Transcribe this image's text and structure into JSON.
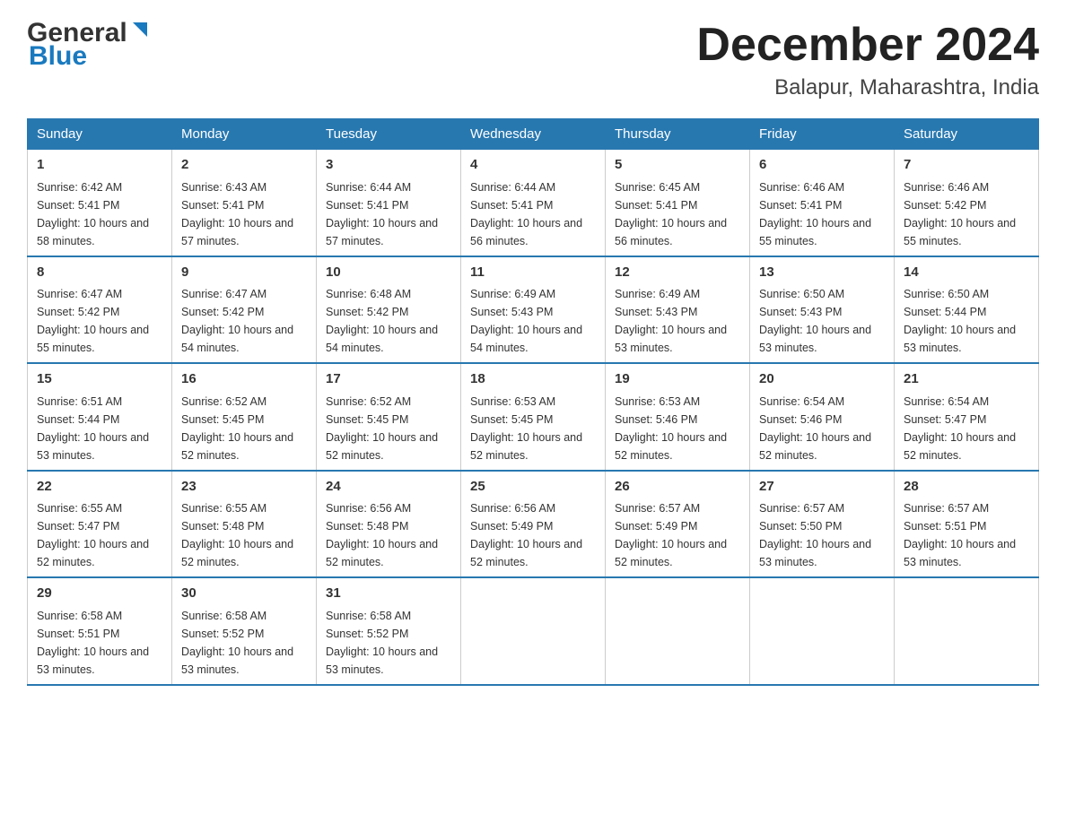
{
  "header": {
    "logo_line1": "General",
    "logo_line2": "Blue",
    "title": "December 2024",
    "subtitle": "Balapur, Maharashtra, India"
  },
  "days_of_week": [
    "Sunday",
    "Monday",
    "Tuesday",
    "Wednesday",
    "Thursday",
    "Friday",
    "Saturday"
  ],
  "weeks": [
    [
      {
        "num": "1",
        "sunrise": "6:42 AM",
        "sunset": "5:41 PM",
        "daylight": "10 hours and 58 minutes."
      },
      {
        "num": "2",
        "sunrise": "6:43 AM",
        "sunset": "5:41 PM",
        "daylight": "10 hours and 57 minutes."
      },
      {
        "num": "3",
        "sunrise": "6:44 AM",
        "sunset": "5:41 PM",
        "daylight": "10 hours and 57 minutes."
      },
      {
        "num": "4",
        "sunrise": "6:44 AM",
        "sunset": "5:41 PM",
        "daylight": "10 hours and 56 minutes."
      },
      {
        "num": "5",
        "sunrise": "6:45 AM",
        "sunset": "5:41 PM",
        "daylight": "10 hours and 56 minutes."
      },
      {
        "num": "6",
        "sunrise": "6:46 AM",
        "sunset": "5:41 PM",
        "daylight": "10 hours and 55 minutes."
      },
      {
        "num": "7",
        "sunrise": "6:46 AM",
        "sunset": "5:42 PM",
        "daylight": "10 hours and 55 minutes."
      }
    ],
    [
      {
        "num": "8",
        "sunrise": "6:47 AM",
        "sunset": "5:42 PM",
        "daylight": "10 hours and 55 minutes."
      },
      {
        "num": "9",
        "sunrise": "6:47 AM",
        "sunset": "5:42 PM",
        "daylight": "10 hours and 54 minutes."
      },
      {
        "num": "10",
        "sunrise": "6:48 AM",
        "sunset": "5:42 PM",
        "daylight": "10 hours and 54 minutes."
      },
      {
        "num": "11",
        "sunrise": "6:49 AM",
        "sunset": "5:43 PM",
        "daylight": "10 hours and 54 minutes."
      },
      {
        "num": "12",
        "sunrise": "6:49 AM",
        "sunset": "5:43 PM",
        "daylight": "10 hours and 53 minutes."
      },
      {
        "num": "13",
        "sunrise": "6:50 AM",
        "sunset": "5:43 PM",
        "daylight": "10 hours and 53 minutes."
      },
      {
        "num": "14",
        "sunrise": "6:50 AM",
        "sunset": "5:44 PM",
        "daylight": "10 hours and 53 minutes."
      }
    ],
    [
      {
        "num": "15",
        "sunrise": "6:51 AM",
        "sunset": "5:44 PM",
        "daylight": "10 hours and 53 minutes."
      },
      {
        "num": "16",
        "sunrise": "6:52 AM",
        "sunset": "5:45 PM",
        "daylight": "10 hours and 52 minutes."
      },
      {
        "num": "17",
        "sunrise": "6:52 AM",
        "sunset": "5:45 PM",
        "daylight": "10 hours and 52 minutes."
      },
      {
        "num": "18",
        "sunrise": "6:53 AM",
        "sunset": "5:45 PM",
        "daylight": "10 hours and 52 minutes."
      },
      {
        "num": "19",
        "sunrise": "6:53 AM",
        "sunset": "5:46 PM",
        "daylight": "10 hours and 52 minutes."
      },
      {
        "num": "20",
        "sunrise": "6:54 AM",
        "sunset": "5:46 PM",
        "daylight": "10 hours and 52 minutes."
      },
      {
        "num": "21",
        "sunrise": "6:54 AM",
        "sunset": "5:47 PM",
        "daylight": "10 hours and 52 minutes."
      }
    ],
    [
      {
        "num": "22",
        "sunrise": "6:55 AM",
        "sunset": "5:47 PM",
        "daylight": "10 hours and 52 minutes."
      },
      {
        "num": "23",
        "sunrise": "6:55 AM",
        "sunset": "5:48 PM",
        "daylight": "10 hours and 52 minutes."
      },
      {
        "num": "24",
        "sunrise": "6:56 AM",
        "sunset": "5:48 PM",
        "daylight": "10 hours and 52 minutes."
      },
      {
        "num": "25",
        "sunrise": "6:56 AM",
        "sunset": "5:49 PM",
        "daylight": "10 hours and 52 minutes."
      },
      {
        "num": "26",
        "sunrise": "6:57 AM",
        "sunset": "5:49 PM",
        "daylight": "10 hours and 52 minutes."
      },
      {
        "num": "27",
        "sunrise": "6:57 AM",
        "sunset": "5:50 PM",
        "daylight": "10 hours and 53 minutes."
      },
      {
        "num": "28",
        "sunrise": "6:57 AM",
        "sunset": "5:51 PM",
        "daylight": "10 hours and 53 minutes."
      }
    ],
    [
      {
        "num": "29",
        "sunrise": "6:58 AM",
        "sunset": "5:51 PM",
        "daylight": "10 hours and 53 minutes."
      },
      {
        "num": "30",
        "sunrise": "6:58 AM",
        "sunset": "5:52 PM",
        "daylight": "10 hours and 53 minutes."
      },
      {
        "num": "31",
        "sunrise": "6:58 AM",
        "sunset": "5:52 PM",
        "daylight": "10 hours and 53 minutes."
      },
      null,
      null,
      null,
      null
    ]
  ]
}
